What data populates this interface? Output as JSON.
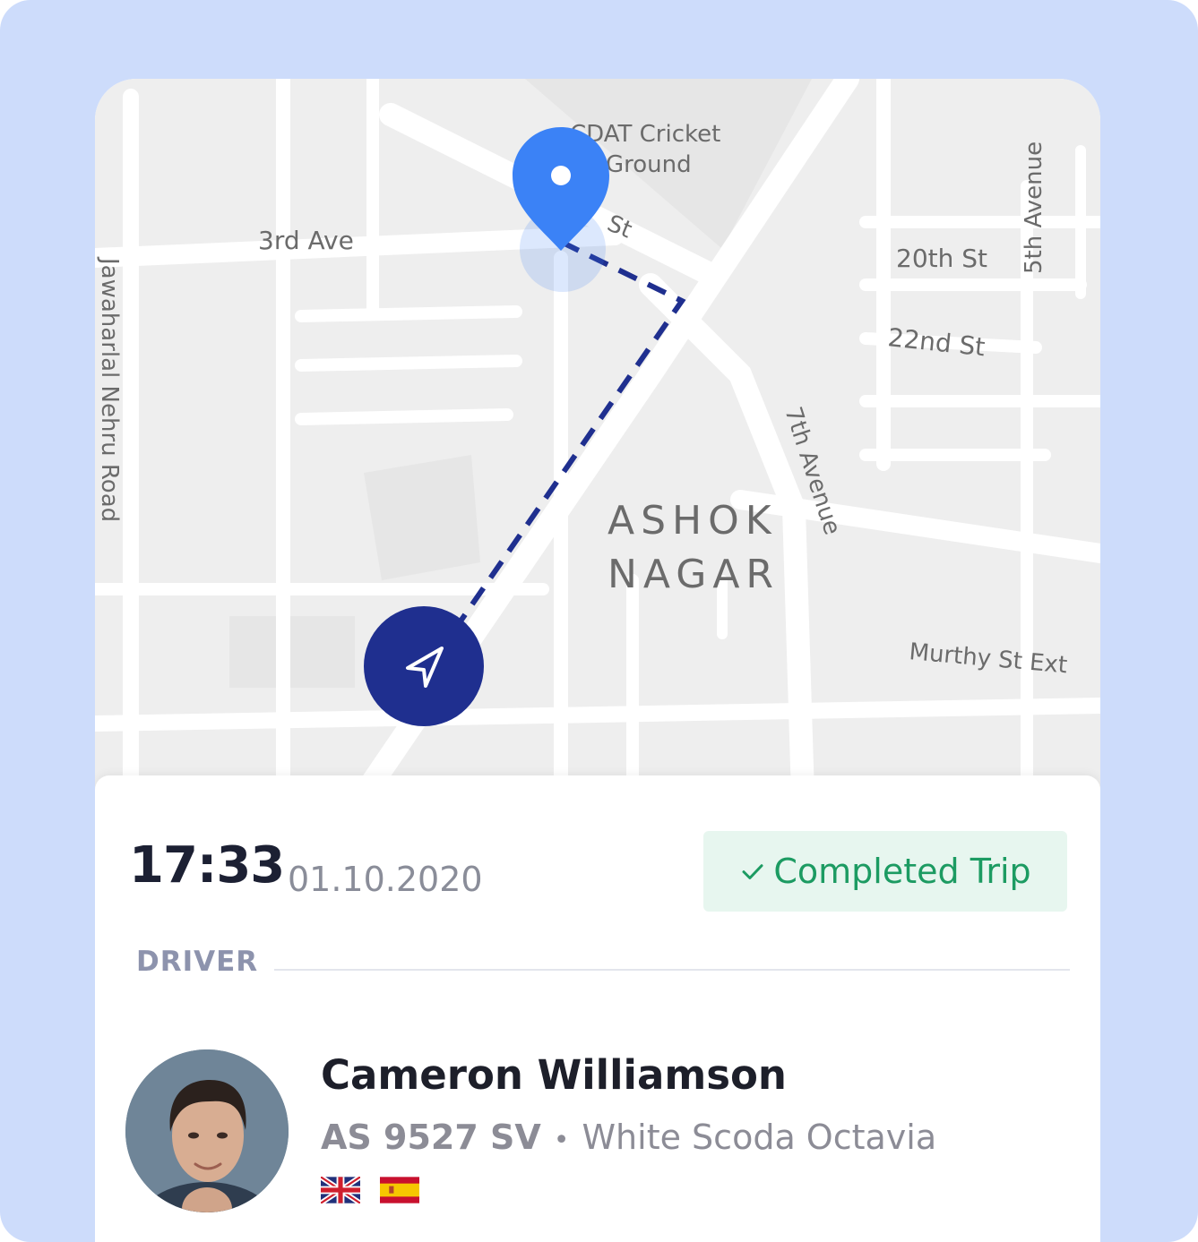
{
  "map": {
    "labels": {
      "ground_line1": "CDAT Cricket",
      "ground_line2": "Ground",
      "street_near_pin": "St",
      "third_ave": "3rd Ave",
      "twentieth_st": "20th St",
      "twenty_second_st": "22nd St",
      "fifth_avenue": "5th Avenue",
      "seventh_avenue": "7th Avenue",
      "nehru_road": "Jawaharlal Nehru Road",
      "area_line1": "ASHOK",
      "area_line2": "NAGAR",
      "murthy": "Murthy St Ext"
    },
    "colors": {
      "pin": "#3b82f6",
      "route": "#1f2f8f",
      "vehicle_marker": "#1f2f8f"
    },
    "icons": {
      "destination": "location-pin-icon",
      "current_position": "navigation-arrow-icon"
    }
  },
  "trip": {
    "time": "17:33",
    "date": "01.10.2020",
    "status": "Completed Trip",
    "status_icon": "checkmark-icon",
    "status_color": "#1c9b62"
  },
  "driver": {
    "section_label": "DRIVER",
    "name": "Cameron Williamson",
    "plate": "AS 9527 SV",
    "separator": "•",
    "car": "White Scoda Octavia",
    "languages": [
      "uk-flag-icon",
      "spain-flag-icon"
    ]
  }
}
